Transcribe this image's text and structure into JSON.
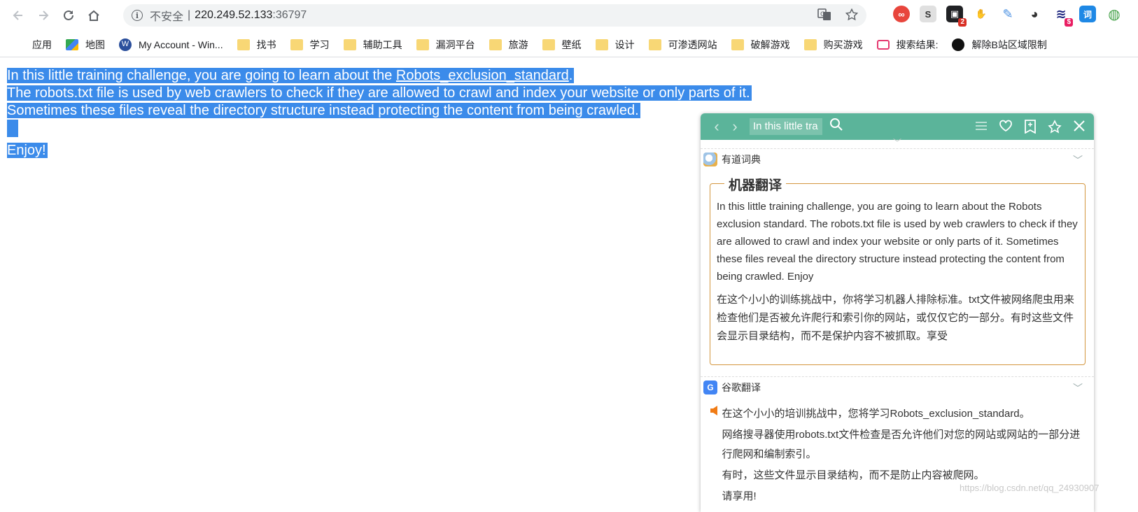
{
  "browser": {
    "url_insecure": "不安全",
    "url_sep": "|",
    "url_host": "220.249.52.133",
    "url_port": ":36797"
  },
  "extensions": [
    {
      "name": "infinity",
      "color": "#e8453c",
      "glyph": "∞",
      "badge": ""
    },
    {
      "name": "s-ext",
      "color": "#9e9e9e",
      "glyph": "S",
      "badge": ""
    },
    {
      "name": "game",
      "color": "#202124",
      "glyph": "▣",
      "badge": "2"
    },
    {
      "name": "hand",
      "color": "#bdbdbd",
      "glyph": "✋",
      "badge": ""
    },
    {
      "name": "leaf",
      "color": "#4a90e2",
      "glyph": "✎",
      "badge": ""
    },
    {
      "name": "ninja",
      "color": "#333333",
      "glyph": "◕",
      "badge": ""
    },
    {
      "name": "money",
      "color": "#1a237e",
      "glyph": "≋",
      "badge": "$"
    },
    {
      "name": "dict",
      "color": "#1e88e5",
      "glyph": "词",
      "badge": ""
    },
    {
      "name": "globe",
      "color": "#43a047",
      "glyph": "◍",
      "badge": ""
    }
  ],
  "bookmarks": [
    {
      "label": "应用",
      "icon": "apps"
    },
    {
      "label": "地图",
      "icon": "maps"
    },
    {
      "label": "My Account - Win...",
      "icon": "w-circle"
    },
    {
      "label": "找书",
      "icon": "folder"
    },
    {
      "label": "学习",
      "icon": "folder"
    },
    {
      "label": "辅助工具",
      "icon": "folder"
    },
    {
      "label": "漏洞平台",
      "icon": "folder"
    },
    {
      "label": "旅游",
      "icon": "folder"
    },
    {
      "label": "壁纸",
      "icon": "folder"
    },
    {
      "label": "设计",
      "icon": "folder"
    },
    {
      "label": "可渗透网站",
      "icon": "folder"
    },
    {
      "label": "破解游戏",
      "icon": "folder"
    },
    {
      "label": "购买游戏",
      "icon": "folder"
    },
    {
      "label": "搜索结果:",
      "icon": "tv"
    },
    {
      "label": "解除B站区域限制",
      "icon": "no-entry"
    }
  ],
  "page": {
    "line1_prefix": "In this little training challenge, you are going to learn about the ",
    "line1_link": "Robots_exclusion_standard",
    "line1_suffix": ".",
    "line2": "The robots.txt file is used by web crawlers to check if they are allowed to crawl and index your website or only parts of it.",
    "line3": "Sometimes these files reveal the directory structure instead protecting the content from being crawled.",
    "line5": "Enjoy!"
  },
  "popup": {
    "search_value": "In this little tra",
    "youdao_label": "有道词典",
    "mt_title": "机器翻译",
    "mt_en": "In this little training challenge, you are going to learn about the Robots exclusion standard. The robots.txt file is used by web crawlers to check if they are allowed to crawl and index your website or only parts of it. Sometimes these files reveal the directory structure instead protecting the content from being crawled. Enjoy",
    "mt_zh": "在这个小小的训练挑战中，你将学习机器人排除标准。txt文件被网络爬虫用来检查他们是否被允许爬行和索引你的网站，或仅仅它的一部分。有时这些文件会显示目录结构，而不是保护内容不被抓取。享受",
    "google_label": "谷歌翻译",
    "gt_lines": [
      "在这个小小的培训挑战中，您将学习Robots_exclusion_standard。",
      "网络搜寻器使用robots.txt文件检查是否允许他们对您的网站或网站的一部分进行爬网和编制索引。",
      "有时，这些文件显示目录结构，而不是防止内容被爬网。",
      "请享用!"
    ]
  },
  "watermark": "https://blog.csdn.net/qq_24930907",
  "colors": {
    "selection": "#3b8bea",
    "popup_header": "#5bb49a",
    "mt_border": "#d3963e"
  }
}
